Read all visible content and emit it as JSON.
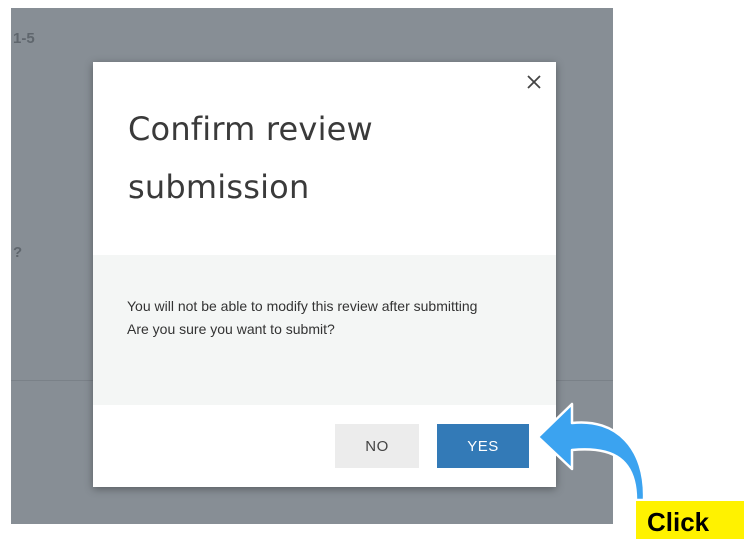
{
  "background": {
    "fragment_top": "1-5",
    "fragment_mid": "?"
  },
  "dialog": {
    "title": "Confirm review submission",
    "close_icon": "close-icon",
    "body_line1": "You will not be able to modify this review after submitting",
    "body_line2": "Are you sure you want to submit?",
    "no_label": "NO",
    "yes_label": "YES"
  },
  "annotation": {
    "label": "Click",
    "arrow_icon": "curved-arrow-icon",
    "label_color": "#fff200",
    "arrow_color": "#3ba3f0"
  },
  "colors": {
    "overlay": "#878e95",
    "primary": "#337ab7",
    "secondary": "#ececec",
    "body_bg": "#f4f6f5"
  }
}
